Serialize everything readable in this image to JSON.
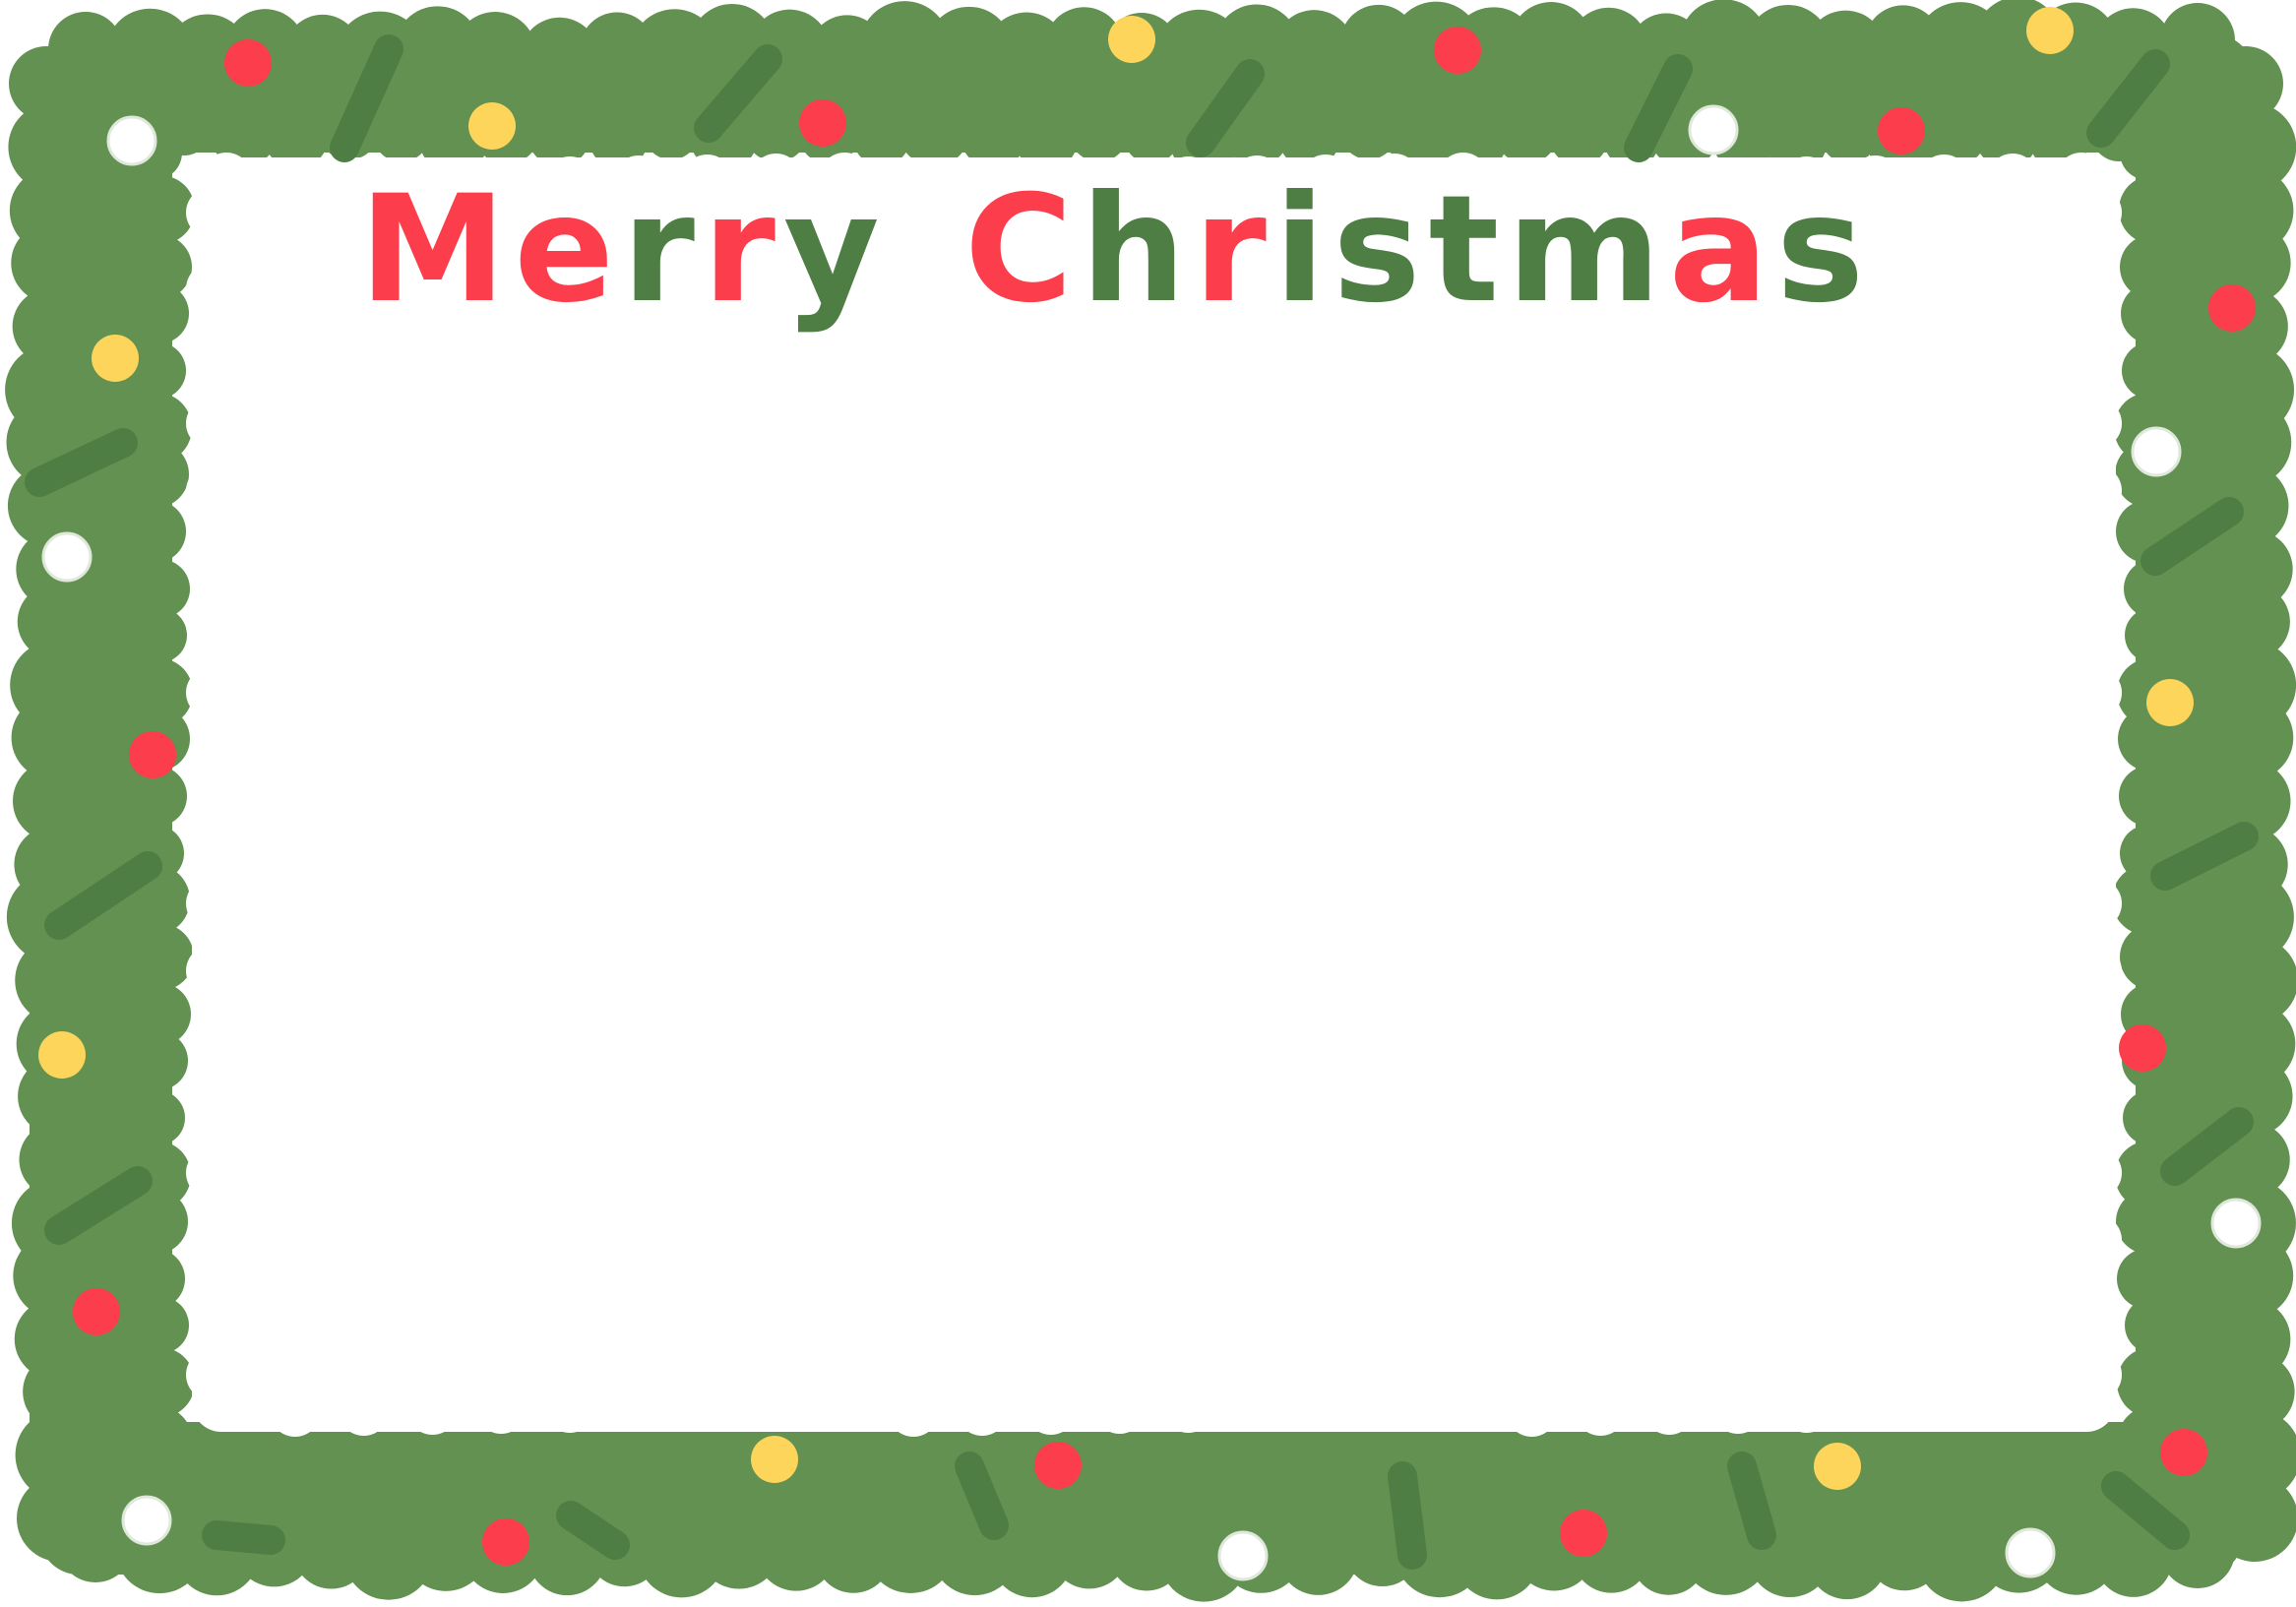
{
  "card": {
    "title_part1": "Merry",
    "title_part2": "Christmas"
  },
  "colors": {
    "background": "#ffffff",
    "garland": "#639151",
    "garland_shade": "#4f7e45",
    "red": "#fc3d4c",
    "dark_green_text": "#4f7e45",
    "yellow": "#fdd55a",
    "white": "#ffffff"
  },
  "decorations": {
    "ornament_colors": [
      "red",
      "yellow",
      "white"
    ],
    "icon": "christmas-garland-frame"
  }
}
